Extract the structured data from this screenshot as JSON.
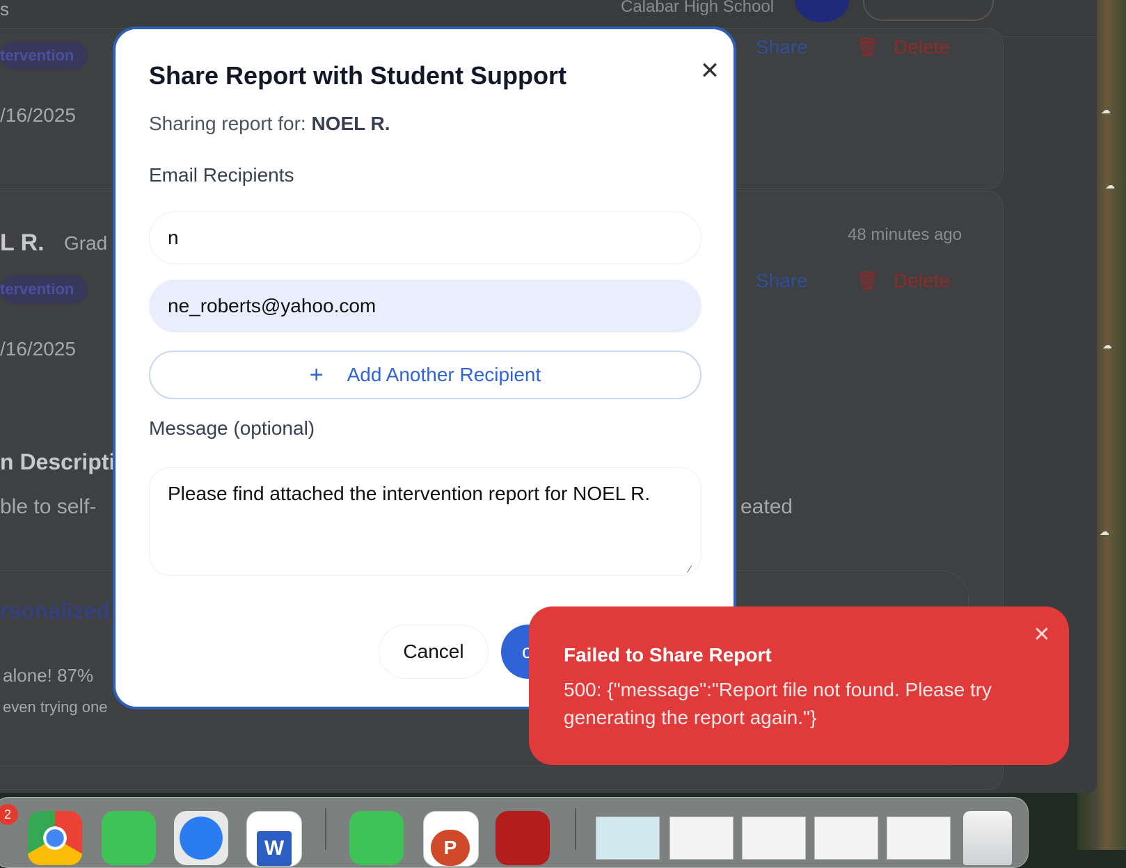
{
  "background": {
    "school_name": "Calabar High School",
    "tag_label": "tervention",
    "date_label": "/16/2025",
    "student_name": "L R.",
    "grade_label": "Grad",
    "time_ago": "48 minutes ago",
    "share_label": "Share",
    "delete_label": "Delete",
    "section_heading": "n Descripti",
    "description_fragment": "ble to self-",
    "description_fragment_right": "eated",
    "personalized_heading": "rsonalized",
    "quote_fragment": "alone! 87%",
    "quote_subtext": "even trying one",
    "top_left_fragment": "s"
  },
  "modal": {
    "title": "Share Report with Student Support",
    "subtitle_prefix": "Sharing report for:",
    "student_name": "NOEL R.",
    "recipients_label": "Email Recipients",
    "recipient_1_value": "n",
    "recipient_2_value": "ne_roberts@yahoo.com",
    "add_recipient_label": "Add Another Recipient",
    "message_label": "Message (optional)",
    "message_value": "Please find attached the intervention report for NOEL R.",
    "cancel_label": "Cancel",
    "send_label": "o"
  },
  "toast": {
    "title": "Failed to Share Report",
    "message": "500: {\"message\":\"Report file not found. Please try generating the report again.\"}"
  },
  "dock": {
    "badge_count": "2"
  },
  "colors": {
    "primary": "#2f63d6",
    "error": "#e03a3a",
    "modal_border": "#2f5fb5"
  }
}
